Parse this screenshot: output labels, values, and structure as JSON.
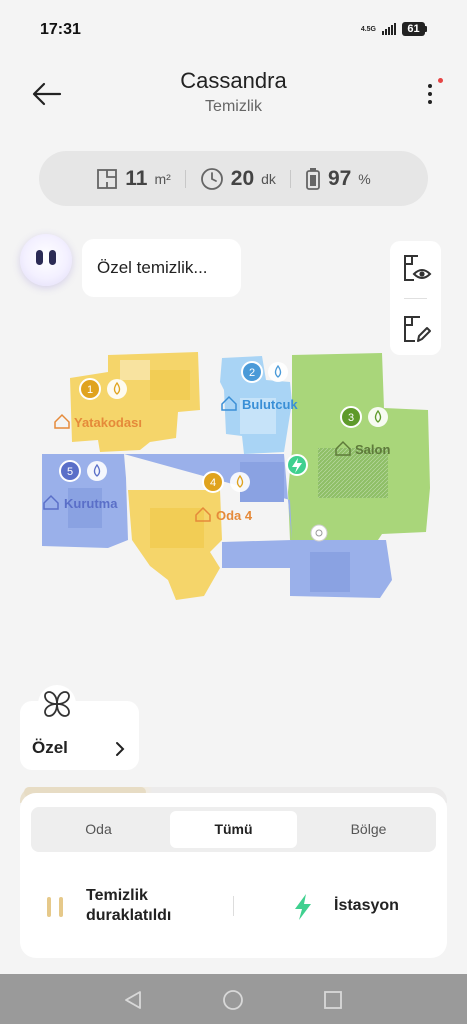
{
  "status_bar": {
    "time": "17:31",
    "network": "4.5G",
    "battery": "61"
  },
  "header": {
    "title": "Cassandra",
    "subtitle": "Temizlik",
    "back_icon": "arrow-left-icon",
    "more_icon": "more-vertical-icon"
  },
  "stats": {
    "area": {
      "value": "11",
      "unit": "m²",
      "icon": "floorplan-icon"
    },
    "time": {
      "value": "20",
      "unit": "dk",
      "icon": "clock-icon"
    },
    "battery": {
      "value": "97",
      "unit": "%",
      "icon": "battery-icon"
    }
  },
  "assistant": {
    "message": "Özel temizlik..."
  },
  "tools": {
    "view_icon": "map-view-icon",
    "edit_icon": "map-edit-icon"
  },
  "map": {
    "rooms": [
      {
        "number": "1",
        "name": "Yatakodası",
        "color": "#f5d56a",
        "label_color": "#e58a3a"
      },
      {
        "number": "2",
        "name": "Bulutcuk",
        "color": "#a9d4f5",
        "label_color": "#3a8fd6"
      },
      {
        "number": "3",
        "name": "Salon",
        "color": "#a9d67a",
        "label_color": "#5e7a3a"
      },
      {
        "number": "4",
        "name": "Oda 4",
        "color": "#f5d56a",
        "label_color": "#e58a3a"
      },
      {
        "number": "5",
        "name": "Kurutma",
        "color": "#9ab0ea",
        "label_color": "#5a6fc8"
      }
    ]
  },
  "mode_card": {
    "label": "Özel",
    "icon": "clover-icon"
  },
  "progress": 0.29,
  "tabs": [
    {
      "label": "Oda",
      "active": false
    },
    {
      "label": "Tümü",
      "active": true
    },
    {
      "label": "Bölge",
      "active": false
    }
  ],
  "actions": {
    "pause_line1": "Temizlik",
    "pause_line2": "duraklatıldı",
    "station": "İstasyon"
  },
  "colors": {
    "accent_gold": "#e6c98a",
    "station_green": "#3fd08f",
    "background": "#f4f4f4"
  }
}
